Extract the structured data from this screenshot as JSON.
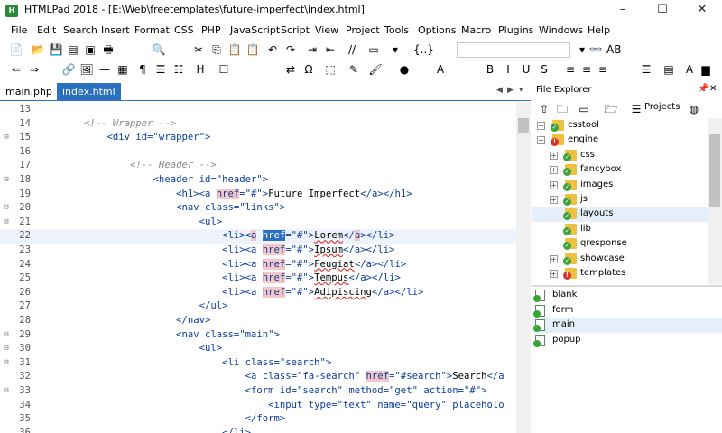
{
  "window": {
    "title": "HTMLPad 2018 - [E:\\Web\\freetemplates\\future-imperfect\\index.html]",
    "app_icon_glyph": "H",
    "controls": [
      "–",
      "☐",
      "✕"
    ]
  },
  "menu": [
    "File",
    "Edit",
    "Search",
    "Insert",
    "Format",
    "CSS",
    "PHP",
    "JavaScript",
    "Script",
    "View",
    "Project",
    "Tools",
    "Options",
    "Macro",
    "Plugins",
    "Windows",
    "Help"
  ],
  "toolbar1": {
    "icons": [
      "new-file-icon",
      "open-icon",
      "save-icon",
      "save-all-icon",
      "close-icon",
      "print-icon",
      "find-icon",
      "cut-icon",
      "copy-icon",
      "paste-icon",
      "paste-special-icon",
      "undo-icon",
      "redo-icon",
      "indent-icon",
      "outdent-icon",
      "comment-icon",
      "window-icon",
      "dropdown-icon",
      "snippet-icon",
      "search-combo-icon",
      "find-next-icon",
      "find-prev-icon"
    ],
    "glyphs": [
      "📄",
      "📂",
      "💾",
      "▤",
      "▣",
      "🖶",
      "🔍",
      "✂",
      "⎘",
      "📋",
      "📋",
      "↶",
      "↷",
      "⇥",
      "⇤",
      "//",
      "▭",
      "▾",
      "{..}",
      "▾",
      "👓",
      "AB"
    ]
  },
  "toolbar2": {
    "icons": [
      "back-icon",
      "forward-icon",
      "link-icon",
      "image-icon",
      "hr-icon",
      "table-icon",
      "paragraph-icon",
      "ul-icon",
      "ol-icon",
      "heading-icon",
      "form-icon",
      "special-char-icon",
      "omega-icon",
      "div-icon",
      "style-icon",
      "brush-icon",
      "color-icon",
      "font-size-icon",
      "bold-icon",
      "italic-icon",
      "underline-icon",
      "strike-icon",
      "align-left-icon",
      "align-center-icon",
      "align-right-icon",
      "list-icon",
      "block-icon",
      "font-color-icon",
      "highlight-icon"
    ],
    "glyphs": [
      "⇐",
      "⇒",
      "🔗",
      "🖼",
      "—",
      "▦",
      "¶",
      "☰",
      "☷",
      "H",
      "☐",
      "⇄",
      "Ω",
      "⬚",
      "✎",
      "🖌",
      "●",
      "A",
      "B",
      "I",
      "U",
      "S",
      "≡",
      "≡",
      "≡",
      "☰",
      "▤",
      "A",
      "▆"
    ]
  },
  "tabs": [
    {
      "label": "main.php",
      "active": false
    },
    {
      "label": "index.html",
      "active": true
    }
  ],
  "tab_nav": [
    "◀",
    "▶",
    "▾"
  ],
  "editor": {
    "current_line": 22,
    "lines": [
      {
        "n": "13",
        "fold": "",
        "segs": []
      },
      {
        "n": "14",
        "fold": "",
        "segs": [
          {
            "t": "        <!-- Wrapper -->",
            "c": "c-cmt"
          }
        ]
      },
      {
        "n": "15",
        "fold": "⊟",
        "segs": [
          {
            "t": "            <div id=\"wrapper\">",
            "c": "c-tag"
          }
        ]
      },
      {
        "n": "16",
        "fold": "",
        "segs": []
      },
      {
        "n": "17",
        "fold": "",
        "segs": [
          {
            "t": "                <!-- Header -->",
            "c": "c-cmt"
          }
        ]
      },
      {
        "n": "18",
        "fold": "⊟",
        "segs": [
          {
            "t": "                    <header id=\"header\">",
            "c": "c-tag"
          }
        ]
      },
      {
        "n": "19",
        "fold": "",
        "segs": [
          {
            "t": "                        <h1><a ",
            "c": "c-tag"
          },
          {
            "t": "href",
            "c": "c-tag c-hl"
          },
          {
            "t": "=\"#\">",
            "c": "c-tag"
          },
          {
            "t": "Future Imperfect",
            "c": "c-txt"
          },
          {
            "t": "</a></h1>",
            "c": "c-tag"
          }
        ]
      },
      {
        "n": "20",
        "fold": "⊟",
        "segs": [
          {
            "t": "                        <nav class=\"links\">",
            "c": "c-tag"
          }
        ]
      },
      {
        "n": "21",
        "fold": "⊟",
        "segs": [
          {
            "t": "                            <ul>",
            "c": "c-tag"
          }
        ]
      },
      {
        "n": "22",
        "fold": "",
        "segs": [
          {
            "t": "                                <li><",
            "c": "c-tag"
          },
          {
            "t": "a",
            "c": "c-tag c-hl"
          },
          {
            "t": " ",
            "c": "c-tag"
          },
          {
            "t": "href",
            "c": "c-sel"
          },
          {
            "t": "=\"#\">",
            "c": "c-tag"
          },
          {
            "t": "Lorem",
            "c": "c-txt c-sq"
          },
          {
            "t": "</",
            "c": "c-tag"
          },
          {
            "t": "a",
            "c": "c-tag c-hl"
          },
          {
            "t": "></li>",
            "c": "c-tag"
          }
        ]
      },
      {
        "n": "23",
        "fold": "",
        "segs": [
          {
            "t": "                                <li><a ",
            "c": "c-tag"
          },
          {
            "t": "href",
            "c": "c-tag c-hl"
          },
          {
            "t": "=\"#\">",
            "c": "c-tag"
          },
          {
            "t": "Ipsum",
            "c": "c-txt c-sq"
          },
          {
            "t": "</a></li>",
            "c": "c-tag"
          }
        ]
      },
      {
        "n": "24",
        "fold": "",
        "segs": [
          {
            "t": "                                <li><a ",
            "c": "c-tag"
          },
          {
            "t": "href",
            "c": "c-tag c-hl"
          },
          {
            "t": "=\"#\">",
            "c": "c-tag"
          },
          {
            "t": "Feugiat",
            "c": "c-txt c-sq"
          },
          {
            "t": "</a></li>",
            "c": "c-tag"
          }
        ]
      },
      {
        "n": "25",
        "fold": "",
        "segs": [
          {
            "t": "                                <li><a ",
            "c": "c-tag"
          },
          {
            "t": "href",
            "c": "c-tag c-hl"
          },
          {
            "t": "=\"#\">",
            "c": "c-tag"
          },
          {
            "t": "Tempus",
            "c": "c-txt c-sq"
          },
          {
            "t": "</a></li>",
            "c": "c-tag"
          }
        ]
      },
      {
        "n": "26",
        "fold": "",
        "segs": [
          {
            "t": "                                <li><a ",
            "c": "c-tag"
          },
          {
            "t": "href",
            "c": "c-tag c-hl"
          },
          {
            "t": "=\"#\">",
            "c": "c-tag"
          },
          {
            "t": "Adipiscing",
            "c": "c-txt c-sq"
          },
          {
            "t": "</a></li>",
            "c": "c-tag"
          }
        ]
      },
      {
        "n": "27",
        "fold": "",
        "segs": [
          {
            "t": "                            </ul>",
            "c": "c-tag"
          }
        ]
      },
      {
        "n": "28",
        "fold": "",
        "segs": [
          {
            "t": "                        </nav>",
            "c": "c-tag"
          }
        ]
      },
      {
        "n": "29",
        "fold": "⊟",
        "segs": [
          {
            "t": "                        <nav class=\"main\">",
            "c": "c-tag"
          }
        ]
      },
      {
        "n": "30",
        "fold": "⊟",
        "segs": [
          {
            "t": "                            <ul>",
            "c": "c-tag"
          }
        ]
      },
      {
        "n": "31",
        "fold": "⊟",
        "segs": [
          {
            "t": "                                <li class=\"search\">",
            "c": "c-tag"
          }
        ]
      },
      {
        "n": "32",
        "fold": "",
        "segs": [
          {
            "t": "                                    <a class=\"fa-search\" ",
            "c": "c-tag"
          },
          {
            "t": "href",
            "c": "c-tag c-hl"
          },
          {
            "t": "=\"#search\">",
            "c": "c-tag"
          },
          {
            "t": "Search",
            "c": "c-txt"
          },
          {
            "t": "</a",
            "c": "c-tag"
          }
        ]
      },
      {
        "n": "33",
        "fold": "⊟",
        "segs": [
          {
            "t": "                                    <form id=\"search\" method=\"get\" action=\"#\">",
            "c": "c-tag"
          }
        ]
      },
      {
        "n": "34",
        "fold": "",
        "segs": [
          {
            "t": "                                        <input type=\"text\" name=\"query\" placeholo",
            "c": "c-tag"
          }
        ]
      },
      {
        "n": "35",
        "fold": "",
        "segs": [
          {
            "t": "                                    </form>",
            "c": "c-tag"
          }
        ]
      },
      {
        "n": "36",
        "fold": "",
        "segs": [
          {
            "t": "                                </li>",
            "c": "c-tag"
          }
        ]
      }
    ]
  },
  "file_explorer": {
    "title": "File Explorer",
    "pin": "📌",
    "close": "✕",
    "projects_label": "Projects",
    "toolbar_icons": [
      "up-folder-icon",
      "folder-icon",
      "view-icon",
      "folder-open-icon",
      "projects-icon",
      "globe-icon"
    ],
    "toolbar_glyphs": [
      "⇧",
      "🗀",
      "▭",
      "🗁",
      "☰",
      "◍"
    ],
    "tree": [
      {
        "label": "csstool",
        "depth": 0,
        "expander": "+",
        "badge": "✓",
        "badge_color": "#3aa33a",
        "selected": false
      },
      {
        "label": "engine",
        "depth": 0,
        "expander": "−",
        "badge": "!",
        "badge_color": "#d8322b",
        "selected": false
      },
      {
        "label": "css",
        "depth": 1,
        "expander": "+",
        "badge": "✓",
        "badge_color": "#3aa33a",
        "selected": false
      },
      {
        "label": "fancybox",
        "depth": 1,
        "expander": "+",
        "badge": "✓",
        "badge_color": "#3aa33a",
        "selected": false
      },
      {
        "label": "images",
        "depth": 1,
        "expander": "+",
        "badge": "✓",
        "badge_color": "#3aa33a",
        "selected": false
      },
      {
        "label": "js",
        "depth": 1,
        "expander": "+",
        "badge": "✓",
        "badge_color": "#3aa33a",
        "selected": false
      },
      {
        "label": "layouts",
        "depth": 1,
        "expander": "",
        "badge": "✓",
        "badge_color": "#3aa33a",
        "selected": true
      },
      {
        "label": "lib",
        "depth": 1,
        "expander": "",
        "badge": "✓",
        "badge_color": "#3aa33a",
        "selected": false
      },
      {
        "label": "qresponse",
        "depth": 1,
        "expander": "",
        "badge": "✓",
        "badge_color": "#3aa33a",
        "selected": false
      },
      {
        "label": "showcase",
        "depth": 1,
        "expander": "+",
        "badge": "✓",
        "badge_color": "#3aa33a",
        "selected": false
      },
      {
        "label": "templates",
        "depth": 1,
        "expander": "+",
        "badge": "!",
        "badge_color": "#d8322b",
        "selected": false
      }
    ],
    "files": [
      {
        "label": "blank",
        "selected": false
      },
      {
        "label": "form",
        "selected": false
      },
      {
        "label": "main",
        "selected": true
      },
      {
        "label": "popup",
        "selected": false
      }
    ]
  },
  "colors": {
    "accent": "#2b6fc0",
    "tag": "#0b3c9e",
    "comment": "#8a8a8a",
    "attr_highlight": "#f3c7c7"
  }
}
